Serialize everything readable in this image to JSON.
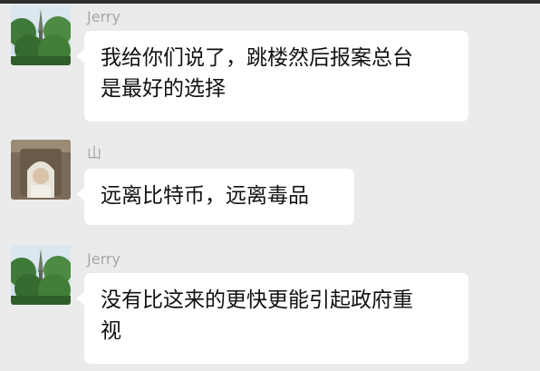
{
  "messages": [
    {
      "sender": "Jerry",
      "avatar_icon": "park-tree-avatar-icon",
      "lines": [
        "我给你们说了，跳楼然后报案总台",
        "是最好的选择"
      ]
    },
    {
      "sender": "山",
      "avatar_icon": "portrait-avatar-icon",
      "lines": [
        "远离比特币，远离毒品"
      ]
    },
    {
      "sender": "Jerry",
      "avatar_icon": "park-tree-avatar-icon",
      "lines": [
        "没有比这来的更快更能引起政府重",
        "视"
      ]
    }
  ],
  "colors": {
    "background": "#ebebeb",
    "bubble": "#ffffff",
    "sender_name": "#a6a6a6",
    "message_text": "#111111",
    "top_bar": "#2e2e2e"
  }
}
